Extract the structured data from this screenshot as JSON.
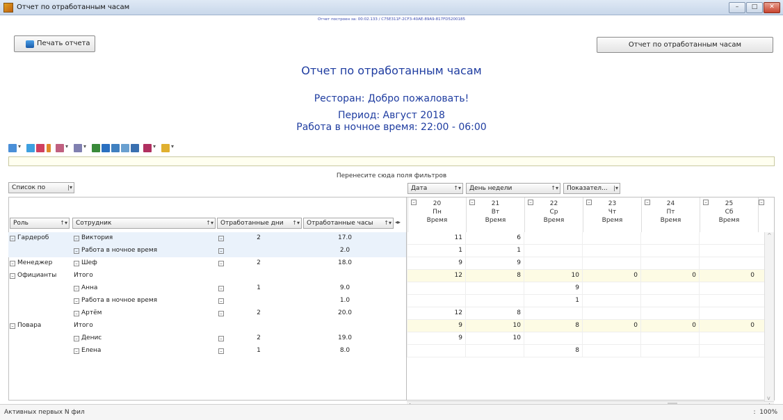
{
  "window": {
    "title": "Отчет по отработанным часам",
    "min": "–",
    "max": "□",
    "close": "✕"
  },
  "header": {
    "build_info": "Отчет построен за: 00:02.133 / C75E311F-2CF3-40AE-89A9-817FD5200185",
    "print_button": "Печать отчета",
    "report_button": "Отчет по отработанным часам",
    "title": "Отчет по отработанным часам",
    "restaurant": "Ресторан: Добро пожаловать!",
    "period": "Период: Август 2018",
    "night_work": "Работа в ночное время: 22:00 - 06:00"
  },
  "pivot": {
    "filter_drop_hint": "Перенесите сюда поля фильтров",
    "list_by": "Список по",
    "column_fields": [
      "Дата",
      "День недели",
      "Показател..."
    ],
    "row_headers": [
      "Роль",
      "Сотрудник",
      "Отработанные дни",
      "Отработанные часы"
    ],
    "days": [
      {
        "num": "20",
        "dow": "Пн",
        "measure": "Время"
      },
      {
        "num": "21",
        "dow": "Вт",
        "measure": "Время"
      },
      {
        "num": "22",
        "dow": "Ср",
        "measure": "Время"
      },
      {
        "num": "23",
        "dow": "Чт",
        "measure": "Время"
      },
      {
        "num": "24",
        "dow": "Пт",
        "measure": "Время"
      },
      {
        "num": "25",
        "dow": "Сб",
        "measure": "Время"
      }
    ],
    "rows": [
      {
        "role": "Гардероб",
        "employee": "Виктория",
        "days": "2",
        "hours": "17.0",
        "vals": [
          "11",
          "6",
          "",
          "",
          "",
          ""
        ]
      },
      {
        "role": "",
        "employee": "Работа в ночное время",
        "days": "",
        "hours": "2.0",
        "vals": [
          "1",
          "1",
          "",
          "",
          "",
          ""
        ]
      },
      {
        "role": "Менеджер",
        "employee": "Шеф",
        "days": "2",
        "hours": "18.0",
        "vals": [
          "9",
          "9",
          "",
          "",
          "",
          ""
        ]
      },
      {
        "role": "Официанты",
        "employee": "Итого",
        "days": "",
        "hours": "",
        "vals": [
          "12",
          "8",
          "10",
          "0",
          "0",
          "0"
        ],
        "total": true
      },
      {
        "role": "",
        "employee": "Анна",
        "days": "1",
        "hours": "9.0",
        "vals": [
          "",
          "",
          "9",
          "",
          "",
          ""
        ]
      },
      {
        "role": "",
        "employee": "Работа в ночное время",
        "days": "",
        "hours": "1.0",
        "vals": [
          "",
          "",
          "1",
          "",
          "",
          ""
        ]
      },
      {
        "role": "",
        "employee": "Артём",
        "days": "2",
        "hours": "20.0",
        "vals": [
          "12",
          "8",
          "",
          "",
          "",
          ""
        ]
      },
      {
        "role": "Повара",
        "employee": "Итого",
        "days": "",
        "hours": "",
        "vals": [
          "9",
          "10",
          "8",
          "0",
          "0",
          "0"
        ],
        "total": true
      },
      {
        "role": "",
        "employee": "Денис",
        "days": "2",
        "hours": "19.0",
        "vals": [
          "9",
          "10",
          "",
          "",
          "",
          ""
        ]
      },
      {
        "role": "",
        "employee": "Елена",
        "days": "1",
        "hours": "8.0",
        "vals": [
          "",
          "",
          "8",
          "",
          "",
          ""
        ]
      }
    ]
  },
  "status": {
    "text": "Активных первых N фил",
    "zoom": "100%"
  }
}
